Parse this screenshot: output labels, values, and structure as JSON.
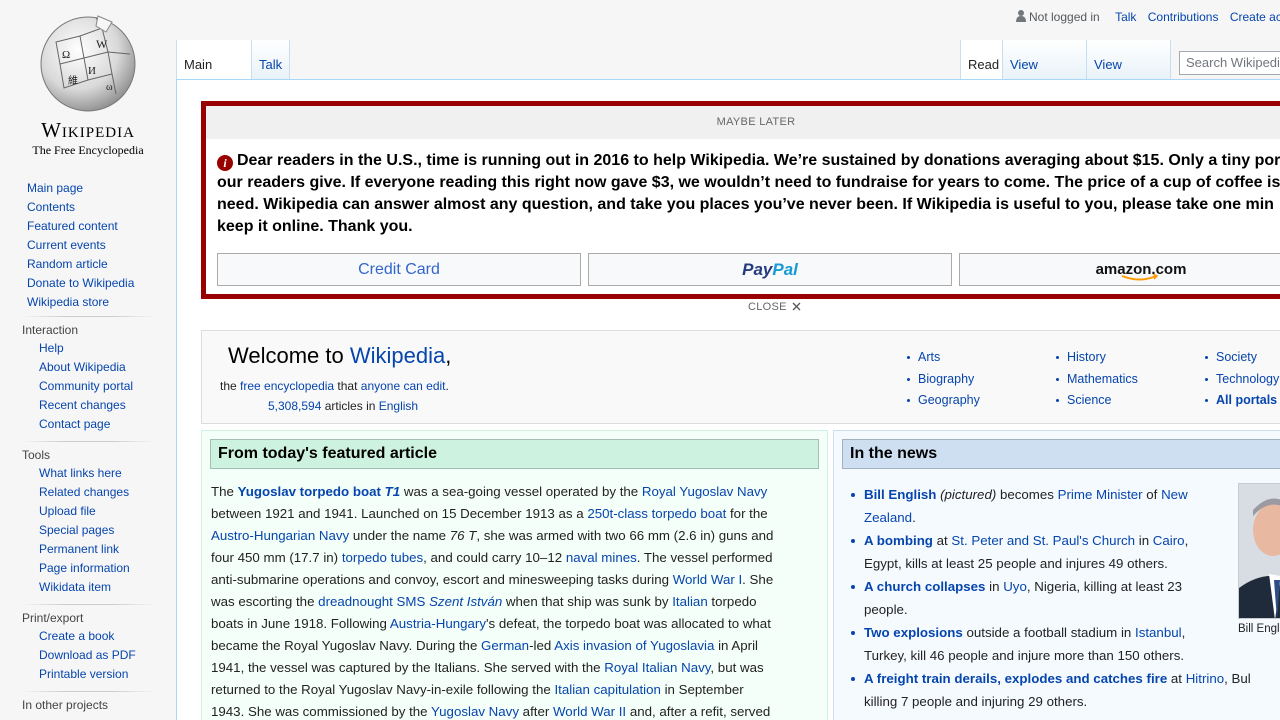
{
  "logo": {
    "wordmark": "Wikipedia",
    "tagline": "The Free Encyclopedia"
  },
  "sidebar": {
    "main": [
      "Main page",
      "Contents",
      "Featured content",
      "Current events",
      "Random article",
      "Donate to Wikipedia",
      "Wikipedia store"
    ],
    "interaction": {
      "heading": "Interaction",
      "items": [
        "Help",
        "About Wikipedia",
        "Community portal",
        "Recent changes",
        "Contact page"
      ]
    },
    "tools": {
      "heading": "Tools",
      "items": [
        "What links here",
        "Related changes",
        "Upload file",
        "Special pages",
        "Permanent link",
        "Page information",
        "Wikidata item"
      ]
    },
    "print": {
      "heading": "Print/export",
      "items": [
        "Create a book",
        "Download as PDF",
        "Printable version"
      ]
    },
    "languages": {
      "heading": "In other projects"
    }
  },
  "personal": {
    "not_logged_in": "Not logged in",
    "talk": "Talk",
    "contributions": "Contributions",
    "create_account": "Create ac"
  },
  "tabs": {
    "main_page": "Main Page",
    "talk": "Talk",
    "read": "Read",
    "view_source": "View source",
    "view_history": "View history"
  },
  "search": {
    "placeholder": "Search Wikipedi"
  },
  "banner": {
    "maybe_later": "MAYBE LATER",
    "lines": [
      "Dear readers in the U.S., time is running out in 2016 to help Wikipedia. We’re sustained by donations averaging about $15. Only a tiny por",
      "our readers give. If everyone reading this right now gave $3, we wouldn’t need to fundraise for years to come. The price of a cup of coffee is",
      "need. Wikipedia can answer almost any question, and take you places you’ve never been. If Wikipedia is useful to you, please take one min",
      "keep it online. Thank you."
    ],
    "credit_card": "Credit Card",
    "paypal_1": "Pay",
    "paypal_2": "Pal",
    "amazon": "amazon.com",
    "close": "CLOSE"
  },
  "welcome": {
    "title_prefix": "Welcome to ",
    "title_link": "Wikipedia",
    "title_suffix": ",",
    "sub_the": "the ",
    "sub_free": "free encyclopedia",
    "sub_that": " that ",
    "sub_edit": "anyone can edit",
    "sub_end": ".",
    "count": "5,308,594",
    "count_mid": " articles in ",
    "count_lang": "English",
    "portals": [
      [
        "Arts",
        "Biography",
        "Geography"
      ],
      [
        "History",
        "Mathematics",
        "Science"
      ],
      [
        "Society",
        "Technology",
        "All portals"
      ]
    ]
  },
  "tfa": {
    "heading": "From today's featured article",
    "lines": [
      [
        [
          "The ",
          ""
        ],
        [
          "Yugoslav torpedo boat ",
          "lb"
        ],
        [
          "T1",
          "lbi"
        ],
        [
          " was a sea-going vessel operated by the ",
          ""
        ],
        [
          "Royal Yugoslav Navy",
          "l"
        ]
      ],
      [
        [
          "between 1921 and 1941. Launched on 15 December 1913 as a ",
          ""
        ],
        [
          "250t-class torpedo boat",
          "l"
        ],
        [
          " for the",
          ""
        ]
      ],
      [
        [
          "Austro-Hungarian Navy",
          "l"
        ],
        [
          " under the name ",
          ""
        ],
        [
          "76 T",
          "i"
        ],
        [
          ", she was armed with two 66 mm (2.6 in) guns and",
          ""
        ]
      ],
      [
        [
          "four 450 mm (17.7 in) ",
          ""
        ],
        [
          "torpedo tubes",
          "l"
        ],
        [
          ", and could carry 10–12 ",
          ""
        ],
        [
          "naval mines",
          "l"
        ],
        [
          ". The vessel performed",
          ""
        ]
      ],
      [
        [
          "anti-submarine operations and convoy, escort and minesweeping tasks during ",
          ""
        ],
        [
          "World War I",
          "l"
        ],
        [
          ". She",
          ""
        ]
      ],
      [
        [
          "was escorting the ",
          ""
        ],
        [
          "dreadnought SMS ",
          "l"
        ],
        [
          "Szent István",
          "li"
        ],
        [
          " when that ship was sunk by ",
          ""
        ],
        [
          "Italian",
          "l"
        ],
        [
          " torpedo",
          ""
        ]
      ],
      [
        [
          "boats in June 1918. Following ",
          ""
        ],
        [
          "Austria-Hungary",
          "l"
        ],
        [
          "'s defeat, the torpedo boat was allocated to what",
          ""
        ]
      ],
      [
        [
          "became the Royal Yugoslav Navy. During the ",
          ""
        ],
        [
          "German",
          "l"
        ],
        [
          "-led ",
          ""
        ],
        [
          "Axis invasion of Yugoslavia",
          "l"
        ],
        [
          " in April",
          ""
        ]
      ],
      [
        [
          "1941, the vessel was captured by the Italians. She served with the ",
          ""
        ],
        [
          "Royal Italian Navy",
          "l"
        ],
        [
          ", but was",
          ""
        ]
      ],
      [
        [
          "returned to the Royal Yugoslav Navy-in-exile following the ",
          ""
        ],
        [
          "Italian capitulation",
          "l"
        ],
        [
          " in September",
          ""
        ]
      ],
      [
        [
          "1943. She was commissioned by the ",
          ""
        ],
        [
          "Yugoslav Navy",
          "l"
        ],
        [
          " after ",
          ""
        ],
        [
          "World War II",
          "l"
        ],
        [
          " and, after a refit, served",
          ""
        ]
      ]
    ]
  },
  "itn": {
    "heading": "In the news",
    "items": [
      [
        [
          [
            "Bill English",
            "lb"
          ],
          [
            " ",
            ""
          ],
          [
            "(pictured)",
            "i"
          ],
          [
            " becomes ",
            ""
          ],
          [
            "Prime Minister",
            "l"
          ],
          [
            " of ",
            ""
          ],
          [
            "New",
            "l"
          ]
        ],
        [
          [
            "Zealand",
            "l"
          ],
          [
            ".",
            ""
          ]
        ]
      ],
      [
        [
          [
            "A bombing",
            "lb"
          ],
          [
            " at ",
            ""
          ],
          [
            "St. Peter and St. Paul's Church",
            "l"
          ],
          [
            " in ",
            ""
          ],
          [
            "Cairo",
            "l"
          ],
          [
            ",",
            ""
          ]
        ],
        [
          [
            "Egypt, kills at least 25 people and injures 49 others.",
            ""
          ]
        ]
      ],
      [
        [
          [
            "A church collapses",
            "lb"
          ],
          [
            " in ",
            ""
          ],
          [
            "Uyo",
            "l"
          ],
          [
            ", Nigeria, killing at least 23",
            ""
          ]
        ],
        [
          [
            "people.",
            ""
          ]
        ]
      ],
      [
        [
          [
            "Two explosions",
            "lb"
          ],
          [
            " outside a football stadium in ",
            ""
          ],
          [
            "Istanbul",
            "l"
          ],
          [
            ",",
            ""
          ]
        ],
        [
          [
            "Turkey, kill 46 people and injure more than 150 others.",
            ""
          ]
        ]
      ],
      [
        [
          [
            "A freight train derails, explodes and catches fire",
            "lb"
          ],
          [
            " at ",
            ""
          ],
          [
            "Hitrino",
            "l"
          ],
          [
            ", Bul",
            ""
          ]
        ],
        [
          [
            "killing 7 people and injuring 29 others.",
            ""
          ]
        ]
      ]
    ],
    "caption": "Bill Engl"
  }
}
